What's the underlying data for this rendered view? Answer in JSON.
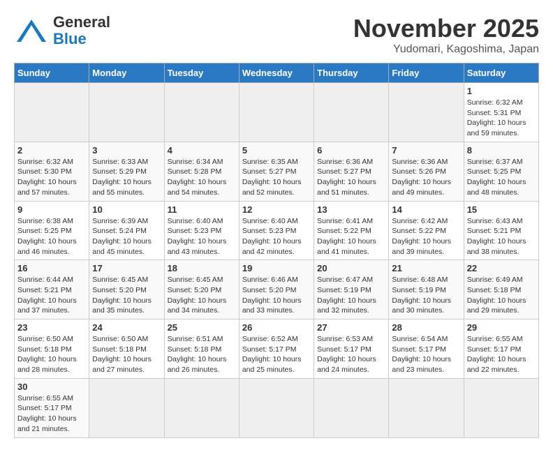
{
  "header": {
    "logo_general": "General",
    "logo_blue": "Blue",
    "month_title": "November 2025",
    "location": "Yudomari, Kagoshima, Japan"
  },
  "days_of_week": [
    "Sunday",
    "Monday",
    "Tuesday",
    "Wednesday",
    "Thursday",
    "Friday",
    "Saturday"
  ],
  "weeks": [
    [
      {
        "day": "",
        "info": ""
      },
      {
        "day": "",
        "info": ""
      },
      {
        "day": "",
        "info": ""
      },
      {
        "day": "",
        "info": ""
      },
      {
        "day": "",
        "info": ""
      },
      {
        "day": "",
        "info": ""
      },
      {
        "day": "1",
        "info": "Sunrise: 6:32 AM\nSunset: 5:31 PM\nDaylight: 10 hours and 59 minutes."
      }
    ],
    [
      {
        "day": "2",
        "info": "Sunrise: 6:32 AM\nSunset: 5:30 PM\nDaylight: 10 hours and 57 minutes."
      },
      {
        "day": "3",
        "info": "Sunrise: 6:33 AM\nSunset: 5:29 PM\nDaylight: 10 hours and 55 minutes."
      },
      {
        "day": "4",
        "info": "Sunrise: 6:34 AM\nSunset: 5:28 PM\nDaylight: 10 hours and 54 minutes."
      },
      {
        "day": "5",
        "info": "Sunrise: 6:35 AM\nSunset: 5:27 PM\nDaylight: 10 hours and 52 minutes."
      },
      {
        "day": "6",
        "info": "Sunrise: 6:36 AM\nSunset: 5:27 PM\nDaylight: 10 hours and 51 minutes."
      },
      {
        "day": "7",
        "info": "Sunrise: 6:36 AM\nSunset: 5:26 PM\nDaylight: 10 hours and 49 minutes."
      },
      {
        "day": "8",
        "info": "Sunrise: 6:37 AM\nSunset: 5:25 PM\nDaylight: 10 hours and 48 minutes."
      }
    ],
    [
      {
        "day": "9",
        "info": "Sunrise: 6:38 AM\nSunset: 5:25 PM\nDaylight: 10 hours and 46 minutes."
      },
      {
        "day": "10",
        "info": "Sunrise: 6:39 AM\nSunset: 5:24 PM\nDaylight: 10 hours and 45 minutes."
      },
      {
        "day": "11",
        "info": "Sunrise: 6:40 AM\nSunset: 5:23 PM\nDaylight: 10 hours and 43 minutes."
      },
      {
        "day": "12",
        "info": "Sunrise: 6:40 AM\nSunset: 5:23 PM\nDaylight: 10 hours and 42 minutes."
      },
      {
        "day": "13",
        "info": "Sunrise: 6:41 AM\nSunset: 5:22 PM\nDaylight: 10 hours and 41 minutes."
      },
      {
        "day": "14",
        "info": "Sunrise: 6:42 AM\nSunset: 5:22 PM\nDaylight: 10 hours and 39 minutes."
      },
      {
        "day": "15",
        "info": "Sunrise: 6:43 AM\nSunset: 5:21 PM\nDaylight: 10 hours and 38 minutes."
      }
    ],
    [
      {
        "day": "16",
        "info": "Sunrise: 6:44 AM\nSunset: 5:21 PM\nDaylight: 10 hours and 37 minutes."
      },
      {
        "day": "17",
        "info": "Sunrise: 6:45 AM\nSunset: 5:20 PM\nDaylight: 10 hours and 35 minutes."
      },
      {
        "day": "18",
        "info": "Sunrise: 6:45 AM\nSunset: 5:20 PM\nDaylight: 10 hours and 34 minutes."
      },
      {
        "day": "19",
        "info": "Sunrise: 6:46 AM\nSunset: 5:20 PM\nDaylight: 10 hours and 33 minutes."
      },
      {
        "day": "20",
        "info": "Sunrise: 6:47 AM\nSunset: 5:19 PM\nDaylight: 10 hours and 32 minutes."
      },
      {
        "day": "21",
        "info": "Sunrise: 6:48 AM\nSunset: 5:19 PM\nDaylight: 10 hours and 30 minutes."
      },
      {
        "day": "22",
        "info": "Sunrise: 6:49 AM\nSunset: 5:18 PM\nDaylight: 10 hours and 29 minutes."
      }
    ],
    [
      {
        "day": "23",
        "info": "Sunrise: 6:50 AM\nSunset: 5:18 PM\nDaylight: 10 hours and 28 minutes."
      },
      {
        "day": "24",
        "info": "Sunrise: 6:50 AM\nSunset: 5:18 PM\nDaylight: 10 hours and 27 minutes."
      },
      {
        "day": "25",
        "info": "Sunrise: 6:51 AM\nSunset: 5:18 PM\nDaylight: 10 hours and 26 minutes."
      },
      {
        "day": "26",
        "info": "Sunrise: 6:52 AM\nSunset: 5:17 PM\nDaylight: 10 hours and 25 minutes."
      },
      {
        "day": "27",
        "info": "Sunrise: 6:53 AM\nSunset: 5:17 PM\nDaylight: 10 hours and 24 minutes."
      },
      {
        "day": "28",
        "info": "Sunrise: 6:54 AM\nSunset: 5:17 PM\nDaylight: 10 hours and 23 minutes."
      },
      {
        "day": "29",
        "info": "Sunrise: 6:55 AM\nSunset: 5:17 PM\nDaylight: 10 hours and 22 minutes."
      }
    ],
    [
      {
        "day": "30",
        "info": "Sunrise: 6:55 AM\nSunset: 5:17 PM\nDaylight: 10 hours and 21 minutes."
      },
      {
        "day": "",
        "info": ""
      },
      {
        "day": "",
        "info": ""
      },
      {
        "day": "",
        "info": ""
      },
      {
        "day": "",
        "info": ""
      },
      {
        "day": "",
        "info": ""
      },
      {
        "day": "",
        "info": ""
      }
    ]
  ]
}
